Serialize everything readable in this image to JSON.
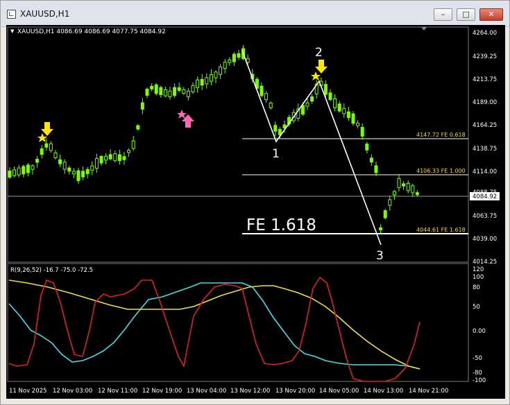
{
  "window": {
    "title": "XAUUSD,H1",
    "buttons": {
      "minimize": "–",
      "maximize": "□",
      "close": "✕"
    }
  },
  "chart_header": {
    "marker": "▼",
    "text": "XAUUSD,H1  4086.69 4086.69 4077.75 4084.92"
  },
  "price_axis": {
    "labels": [
      "4264.00",
      "4239.25",
      "4213.75",
      "4189.00",
      "4164.25",
      "4138.75",
      "4114.00",
      "4088.75",
      "4063.75",
      "4039.00",
      "4014.25"
    ],
    "current_price": "4084.92"
  },
  "fibo_levels": {
    "fe0618": "4147.72  FE 0.618",
    "fe1000": "4106.33  FE 1.000",
    "fe1618": "4044.61  FE 1.618",
    "big_label": "FE 1.618"
  },
  "wave_labels": {
    "p1": "1",
    "p2": "2",
    "p3": "3"
  },
  "indicator": {
    "label": "R(9,26,52) -16.7 -75.0 -72.5",
    "axis_labels": [
      "120",
      "100",
      "80",
      "50",
      "0.00",
      "-50",
      "-80",
      "-100"
    ]
  },
  "time_axis": {
    "labels": [
      "11 Nov 2025",
      "12 Nov 03:00",
      "12 Nov 11:00",
      "12 Nov 19:00",
      "13 Nov 04:00",
      "13 Nov 12:00",
      "13 Nov 20:00",
      "14 Nov 05:00",
      "14 Nov 13:00",
      "14 Nov 21:00"
    ]
  },
  "colors": {
    "background": "#000000",
    "candle": "#7cfc00",
    "fibo": "#ffd700",
    "zigzag": "#ffffff",
    "red_line": "#e02020",
    "cyan_line": "#40e0e8",
    "yellow_line": "#f0e040",
    "arrow_down": "#ffe800",
    "arrow_up": "#ff69b4"
  },
  "icons": {
    "sell_signals": [
      "arrow-down-yellow",
      "arrow-down-yellow"
    ],
    "buy_signal": "arrow-up-pink"
  }
}
